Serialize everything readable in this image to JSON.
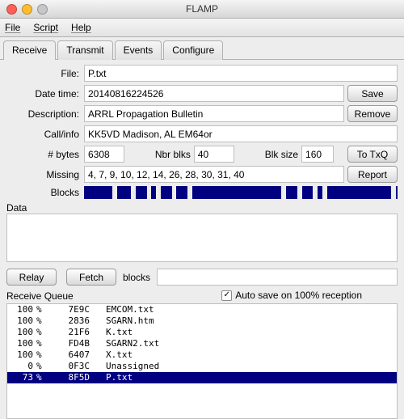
{
  "window": {
    "title": "FLAMP"
  },
  "menu": {
    "file": "File",
    "script": "Script",
    "help": "Help"
  },
  "tabs": {
    "receive": "Receive",
    "transmit": "Transmit",
    "events": "Events",
    "configure": "Configure"
  },
  "labels": {
    "file": "File:",
    "datetime": "Date time:",
    "description": "Description:",
    "callinfo": "Call/info",
    "nbytes": "# bytes",
    "nbrblks": "Nbr blks",
    "blksize": "Blk size",
    "missing": "Missing",
    "blocks": "Blocks",
    "data": "Data",
    "blocks_small": "blocks",
    "autosave": "Auto save on 100% reception",
    "receive_queue": "Receive Queue"
  },
  "buttons": {
    "save": "Save",
    "remove": "Remove",
    "totxq": "To TxQ",
    "report": "Report",
    "relay": "Relay",
    "fetch": "Fetch"
  },
  "fields": {
    "file": "P.txt",
    "datetime": "20140816224526",
    "description": "ARRL Propagation Bulletin",
    "callinfo": "KK5VD Madison, AL EM64or",
    "nbytes": "6308",
    "nbrblks": "40",
    "blksize": "160",
    "missing": "4, 7, 9, 10, 12, 14, 26, 28, 30, 31, 40",
    "blocks_input": "",
    "data": ""
  },
  "autosave_checked": true,
  "queue": [
    {
      "pct": "100",
      "unit": "%",
      "id": "7E9C",
      "name": "EMCOM.txt",
      "sel": false
    },
    {
      "pct": "100",
      "unit": "%",
      "id": "2836",
      "name": "SGARN.htm",
      "sel": false
    },
    {
      "pct": "100",
      "unit": "%",
      "id": "21F6",
      "name": "K.txt",
      "sel": false
    },
    {
      "pct": "100",
      "unit": "%",
      "id": "FD4B",
      "name": "SGARN2.txt",
      "sel": false
    },
    {
      "pct": "100",
      "unit": "%",
      "id": "6407",
      "name": "X.txt",
      "sel": false
    },
    {
      "pct": "0",
      "unit": "%",
      "id": "0F3C",
      "name": "Unassigned",
      "sel": false
    },
    {
      "pct": "73",
      "unit": "%",
      "id": "8F5D",
      "name": "P.txt",
      "sel": true
    }
  ],
  "block_gaps_pct": [
    9,
    15,
    20,
    23,
    28,
    33,
    63,
    68,
    73,
    76,
    98
  ]
}
